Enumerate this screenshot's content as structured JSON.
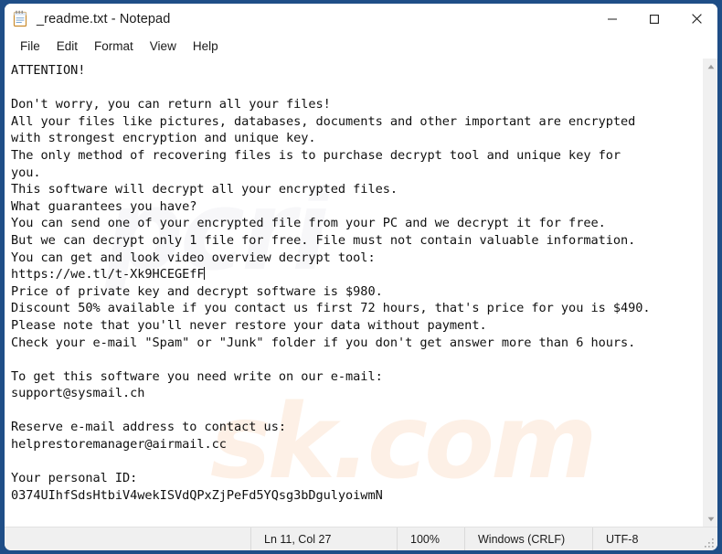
{
  "window": {
    "title": "_readme.txt - Notepad",
    "app_icon": "notepad-icon",
    "border_color": "#1f4e87",
    "controls": {
      "minimize": "Minimize",
      "maximize": "Maximize",
      "close": "Close"
    }
  },
  "menu": {
    "items": [
      {
        "label": "File"
      },
      {
        "label": "Edit"
      },
      {
        "label": "Format"
      },
      {
        "label": "View"
      },
      {
        "label": "Help"
      }
    ]
  },
  "document": {
    "filename": "_readme.txt",
    "lines": [
      "ATTENTION!",
      "",
      "Don't worry, you can return all your files!",
      "All your files like pictures, databases, documents and other important are encrypted",
      "with strongest encryption and unique key.",
      "The only method of recovering files is to purchase decrypt tool and unique key for",
      "you.",
      "This software will decrypt all your encrypted files.",
      "What guarantees you have?",
      "You can send one of your encrypted file from your PC and we decrypt it for free.",
      "But we can decrypt only 1 file for free. File must not contain valuable information.",
      "You can get and look video overview decrypt tool:",
      "https://we.tl/t-Xk9HCEGEfF",
      "Price of private key and decrypt software is $980.",
      "Discount 50% available if you contact us first 72 hours, that's price for you is $490.",
      "Please note that you'll never restore your data without payment.",
      "Check your e-mail \"Spam\" or \"Junk\" folder if you don't get answer more than 6 hours.",
      "",
      "To get this software you need write on our e-mail:",
      "support@sysmail.ch",
      "",
      "Reserve e-mail address to contact us:",
      "helprestoremanager@airmail.cc",
      "",
      "Your personal ID:",
      "0374UIhfSdsHtbiV4wekISVdQPxZjPeFd5YQsg3bDgulyoiwmN"
    ],
    "text_before_caret": "ATTENTION!\n\nDon't worry, you can return all your files!\nAll your files like pictures, databases, documents and other important are encrypted\nwith strongest encryption and unique key.\nThe only method of recovering files is to purchase decrypt tool and unique key for\nyou.\nThis software will decrypt all your encrypted files.\nWhat guarantees you have?\nYou can send one of your encrypted file from your PC and we decrypt it for free.\nBut we can decrypt only 1 file for free. File must not contain valuable information.\nYou can get and look video overview decrypt tool:\nhttps://we.tl/t-Xk9HCEGEfF",
    "text_after_caret": "\nPrice of private key and decrypt software is $980.\nDiscount 50% available if you contact us first 72 hours, that's price for you is $490.\nPlease note that you'll never restore your data without payment.\nCheck your e-mail \"Spam\" or \"Junk\" folder if you don't get answer more than 6 hours.\n\nTo get this software you need write on our e-mail:\nsupport@sysmail.ch\n\nReserve e-mail address to contact us:\nhelprestoremanager@airmail.cc\n\nYour personal ID:\n0374UIhfSdsHtbiV4wekISVdQPxZjPeFd5YQsg3bDgulyoiwmN",
    "ransom_details": {
      "download_url": "https://we.tl/t-Xk9HCEGEfF",
      "price": "$980",
      "discount_price": "$490",
      "discount_percent": "50%",
      "discount_window": "72 hours",
      "response_time": "6 hours",
      "primary_email": "support@sysmail.ch",
      "reserve_email": "helprestoremanager@airmail.cc",
      "personal_id": "0374UIhfSdsHtbiV4wekISVdQPxZjPeFd5YQsg3bDgulyoiwmN"
    }
  },
  "watermark": {
    "text": "sk.com",
    "text2": "pcri"
  },
  "scrollbar": {
    "up_arrow": "chevron-up-icon",
    "down_arrow": "chevron-down-icon"
  },
  "statusbar": {
    "cursor_position": "Ln 11, Col 27",
    "zoom": "100%",
    "line_ending": "Windows (CRLF)",
    "encoding": "UTF-8"
  }
}
